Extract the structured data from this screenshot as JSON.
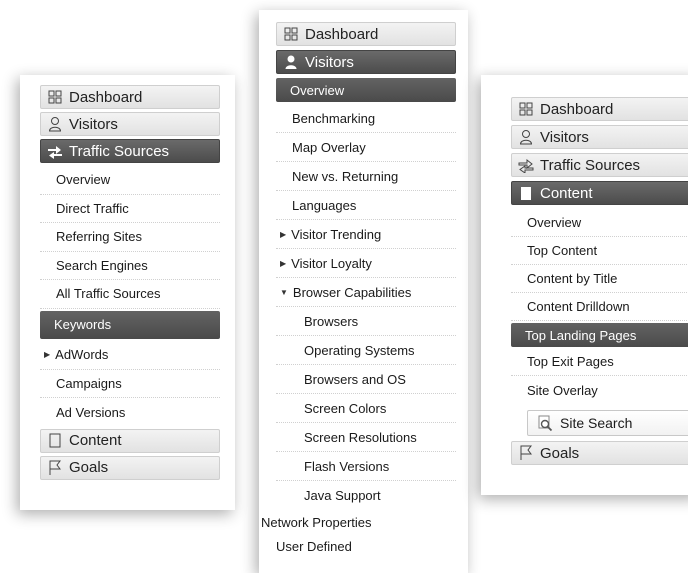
{
  "panel1": {
    "categories": {
      "dashboard": "Dashboard",
      "visitors": "Visitors",
      "traffic_sources": "Traffic Sources",
      "content": "Content",
      "goals": "Goals"
    },
    "items": [
      "Overview",
      "Direct Traffic",
      "Referring Sites",
      "Search Engines",
      "All Traffic Sources",
      "Keywords",
      "AdWords",
      "Campaigns",
      "Ad Versions"
    ],
    "selected_item": "Keywords"
  },
  "panel2": {
    "categories": {
      "dashboard": "Dashboard",
      "visitors": "Visitors"
    },
    "items": [
      "Overview",
      "Benchmarking",
      "Map Overlay",
      "New vs. Returning",
      "Languages",
      "Visitor Trending",
      "Visitor Loyalty",
      "Browser Capabilities"
    ],
    "browser_items": [
      "Browsers",
      "Operating Systems",
      "Browsers and OS",
      "Screen Colors",
      "Screen Resolutions",
      "Flash Versions",
      "Java Support"
    ],
    "network_properties": "Network Properties",
    "user_defined": "User Defined",
    "selected_item": "Overview"
  },
  "panel3": {
    "categories": {
      "dashboard": "Dashboard",
      "visitors": "Visitors",
      "traffic_sources": "Traffic Sources",
      "content": "Content",
      "goals": "Goals"
    },
    "items": [
      "Overview",
      "Top Content",
      "Content by Title",
      "Content Drilldown",
      "Top Landing Pages",
      "Top Exit Pages",
      "Site Overlay"
    ],
    "site_search": "Site Search",
    "selected_item": "Top Landing Pages"
  },
  "icons": {
    "dashboard": "grid-icon",
    "visitors": "person-icon",
    "traffic_sources": "arrows-icon",
    "content": "page-icon",
    "goals": "flag-icon",
    "site_search": "magnifier-icon"
  },
  "colors": {
    "active_dark": "#555555",
    "category_light": "#e8e8e8"
  }
}
